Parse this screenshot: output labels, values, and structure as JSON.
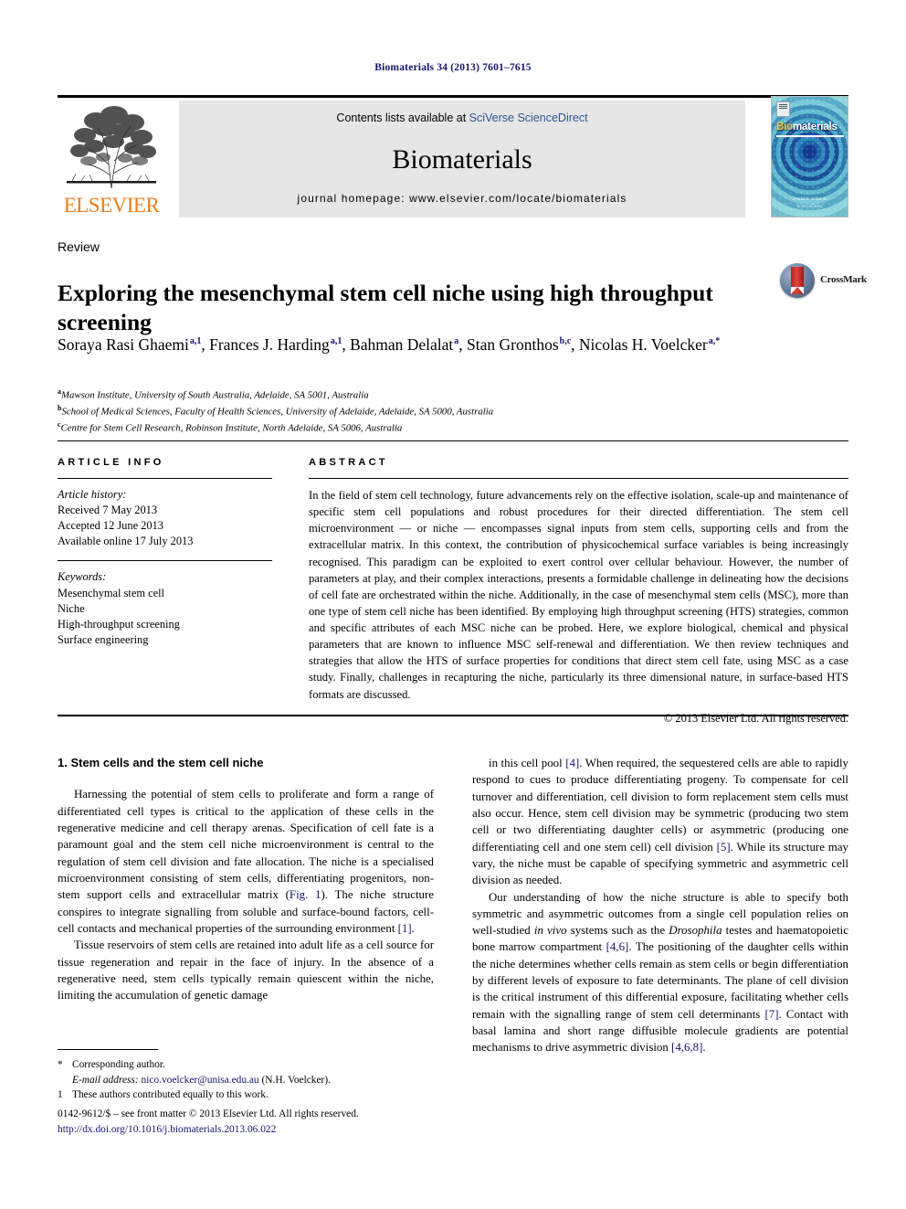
{
  "running_head": "Biomaterials 34 (2013) 7601–7615",
  "masthead": {
    "contents_prefix": "Contents lists available at ",
    "contents_link": "SciVerse ScienceDirect",
    "journal_name": "Biomaterials",
    "homepage": "journal homepage: www.elsevier.com/locate/biomaterials",
    "publisher_logo_text": "ELSEVIER",
    "cover": {
      "title_bio": "Bio",
      "title_rest": "materials",
      "footer_line1": "available online at",
      "footer_line2": "ScienceDirect"
    }
  },
  "article": {
    "doctype": "Review",
    "title": "Exploring the mesenchymal stem cell niche using high throughput screening",
    "crossmark_label": "CrossMark",
    "authors": [
      {
        "name": "Soraya Rasi Ghaemi",
        "marks": "a,1",
        "sep": ", "
      },
      {
        "name": "Frances J. Harding",
        "marks": "a,1",
        "sep": ", "
      },
      {
        "name": "Bahman Delalat",
        "marks": "a",
        "sep": ", "
      },
      {
        "name": "Stan Gronthos",
        "marks": "b,c",
        "sep": ", "
      },
      {
        "name": "Nicolas H. Voelcker",
        "marks": "a,*",
        "sep": ""
      }
    ],
    "affiliations": [
      {
        "mark": "a",
        "text": "Mawson Institute, University of South Australia, Adelaide, SA 5001, Australia"
      },
      {
        "mark": "b",
        "text": "School of Medical Sciences, Faculty of Health Sciences, University of Adelaide, Adelaide, SA 5000, Australia"
      },
      {
        "mark": "c",
        "text": "Centre for Stem Cell Research, Robinson Institute, North Adelaide, SA 5006, Australia"
      }
    ]
  },
  "article_info": {
    "heading": "ARTICLE INFO",
    "history_label": "Article history:",
    "history": [
      "Received 7 May 2013",
      "Accepted 12 June 2013",
      "Available online 17 July 2013"
    ],
    "keywords_label": "Keywords:",
    "keywords": [
      "Mesenchymal stem cell",
      "Niche",
      "High-throughput screening",
      "Surface engineering"
    ]
  },
  "abstract": {
    "heading": "ABSTRACT",
    "text": "In the field of stem cell technology, future advancements rely on the effective isolation, scale-up and maintenance of specific stem cell populations and robust procedures for their directed differentiation. The stem cell microenvironment — or niche — encompasses signal inputs from stem cells, supporting cells and from the extracellular matrix. In this context, the contribution of physicochemical surface variables is being increasingly recognised. This paradigm can be exploited to exert control over cellular behaviour. However, the number of parameters at play, and their complex interactions, presents a formidable challenge in delineating how the decisions of cell fate are orchestrated within the niche. Additionally, in the case of mesenchymal stem cells (MSC), more than one type of stem cell niche has been identified. By employing high throughput screening (HTS) strategies, common and specific attributes of each MSC niche can be probed. Here, we explore biological, chemical and physical parameters that are known to influence MSC self-renewal and differentiation. We then review techniques and strategies that allow the HTS of surface properties for conditions that direct stem cell fate, using MSC as a case study. Finally, challenges in recapturing the niche, particularly its three dimensional nature, in surface-based HTS formats are discussed.",
    "copyright": "© 2013 Elsevier Ltd. All rights reserved."
  },
  "body": {
    "section_heading": "1. Stem cells and the stem cell niche",
    "left_paragraphs": [
      "Harnessing the potential of stem cells to proliferate and form a range of differentiated cell types is critical to the application of these cells in the regenerative medicine and cell therapy arenas. Specification of cell fate is a paramount goal and the stem cell niche microenvironment is central to the regulation of stem cell division and fate allocation. The niche is a specialised microenvironment consisting of stem cells, differentiating progenitors, non-stem support cells and extracellular matrix (Fig. 1). The niche structure conspires to integrate signalling from soluble and surface-bound factors, cell-cell contacts and mechanical properties of the surrounding environment [1].",
      "Tissue reservoirs of stem cells are retained into adult life as a cell source for tissue regeneration and repair in the face of injury. In the absence of a regenerative need, stem cells typically remain quiescent within the niche, limiting the accumulation of genetic damage"
    ],
    "right_paragraphs": [
      "in this cell pool [4]. When required, the sequestered cells are able to rapidly respond to cues to produce differentiating progeny. To compensate for cell turnover and differentiation, cell division to form replacement stem cells must also occur. Hence, stem cell division may be symmetric (producing two stem cell or two differentiating daughter cells) or asymmetric (producing one differentiating cell and one stem cell) cell division [5]. While its structure may vary, the niche must be capable of specifying symmetric and asymmetric cell division as needed.",
      "Our understanding of how the niche structure is able to specify both symmetric and asymmetric outcomes from a single cell population relies on well-studied in vivo systems such as the Drosophila testes and haematopoietic bone marrow compartment [4,6]. The positioning of the daughter cells within the niche determines whether cells remain as stem cells or begin differentiation by different levels of exposure to fate determinants. The plane of cell division is the critical instrument of this differential exposure, facilitating whether cells remain with the signalling range of stem cell determinants [7]. Contact with basal lamina and short range diffusible molecule gradients are potential mechanisms to drive asymmetric division [4,6,8]."
    ]
  },
  "footnotes": {
    "corresponding_mark": "*",
    "corresponding_text": "Corresponding author.",
    "email_label": "E-mail address:",
    "email": "nico.voelcker@unisa.edu.au",
    "email_suffix": "(N.H. Voelcker).",
    "equal_mark": "1",
    "equal_text": "These authors contributed equally to this work."
  },
  "imprint": {
    "line1": "0142-9612/$ – see front matter © 2013 Elsevier Ltd. All rights reserved.",
    "doi": "http://dx.doi.org/10.1016/j.biomaterials.2013.06.022"
  },
  "colors": {
    "link_blue": "#2b5797",
    "ref_navy": "#15136b",
    "elsevier_orange": "#ef7d17"
  }
}
